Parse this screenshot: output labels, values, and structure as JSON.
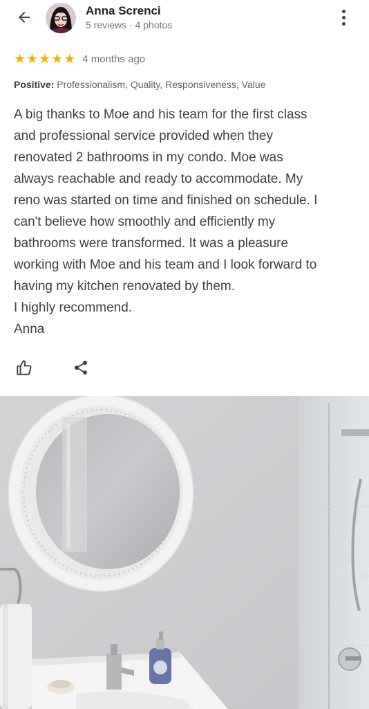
{
  "reviewer": {
    "name": "Anna Screnci",
    "meta": "5 reviews · 4 photos"
  },
  "review": {
    "rating": 5,
    "rating_max": 5,
    "time_ago": "4 months ago",
    "positive_label": "Positive:",
    "positive_values": "Professionalism, Quality, Responsiveness, Value",
    "lines": [
      "A big thanks to Moe and his team for the first class",
      "and professional service provided when they",
      "renovated 2 bathrooms in my condo. Moe was",
      "always reachable and ready to accommodate. My",
      "reno was started on time and finished on schedule. I",
      "can't believe how smoothly and efficiently my",
      "bathrooms were transformed. It was a pleasure",
      "working with Moe and his team and I look forward to",
      "having my kitchen renovated by them.",
      "I highly recommend.",
      "Anna"
    ]
  },
  "icons": {
    "back": "arrow-back-icon",
    "more": "more-vert-icon",
    "like": "thumb-up-icon",
    "share": "share-icon",
    "star": "star-icon"
  },
  "colors": {
    "star": "#f4b400",
    "text_primary": "#202124",
    "text_secondary": "#70757a"
  }
}
